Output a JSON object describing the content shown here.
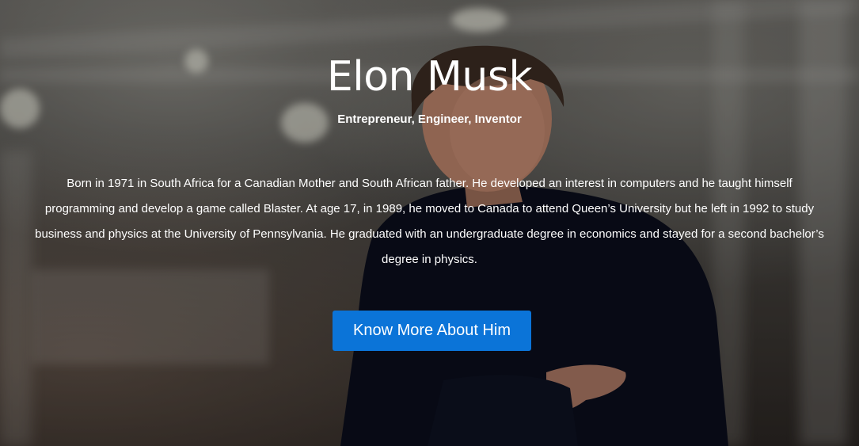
{
  "hero": {
    "name": "Elon Musk",
    "tagline": "Entrepreneur, Engineer, Inventor",
    "bio": "Born in 1971 in South Africa for a Canadian Mother and South African father. He developed an interest in computers and he taught himself programming and develop a game called Blaster. At age 17, in 1989, he moved to Canada to attend Queen’s University but he left in 1992 to study business and physics at the University of Pennsylvania. He graduated with an undergraduate degree in economics and stayed for a second bachelor’s degree in physics.",
    "cta_label": "Know More About Him"
  },
  "colors": {
    "cta_background": "#0b74d8",
    "text": "#ffffff"
  }
}
